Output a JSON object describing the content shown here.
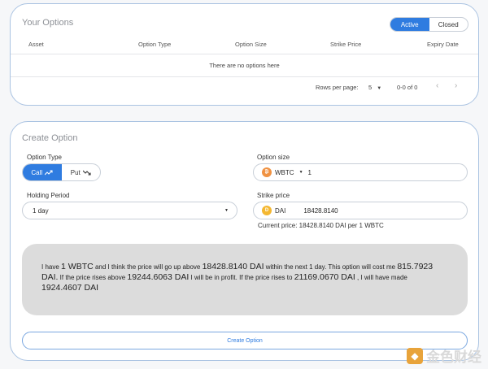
{
  "options": {
    "title": "Your Options",
    "toggle": {
      "active_label": "Active",
      "closed_label": "Closed",
      "selected": "Active"
    },
    "columns": [
      "Asset",
      "Option Type",
      "Option Size",
      "Strike Price",
      "Expiry Date"
    ],
    "empty_text": "There are no options here",
    "pagination": {
      "rows_label": "Rows per page:",
      "rows_value": "5",
      "range": "0-0 of 0"
    }
  },
  "create": {
    "title": "Create Option",
    "option_type": {
      "label": "Option Type",
      "call": "Call",
      "put": "Put",
      "selected": "Call"
    },
    "option_size": {
      "label": "Option size",
      "asset": "WBTC",
      "value": "1"
    },
    "holding_period": {
      "label": "Holding Period",
      "value": "1 day"
    },
    "strike_price": {
      "label": "Strike price",
      "asset": "DAI",
      "value": "18428.8140"
    },
    "current_price": "Current price: 18428.8140 DAI per 1 WBTC",
    "description": {
      "p1": "I have",
      "amount": "1 WBTC",
      "p2": "and I think the price will go up above",
      "strike": "18428.8140 DAI",
      "p3": "within the next 1 day. This option will cost me",
      "cost": "815.7923 DAI.",
      "p4": "If the price rises above",
      "breakeven": "19244.6063 DAI",
      "p5": "I will be in profit. If the price rises to",
      "target": "21169.0670 DAI",
      "p6": ", I will have made",
      "profit": "1924.4607 DAI"
    },
    "submit_label": "Create Option"
  },
  "watermark": {
    "text": "金色财经"
  },
  "colors": {
    "accent": "#2f7ce0",
    "border": "#aac3e2",
    "wbtc": "#f09242",
    "dai": "#f4b731"
  }
}
